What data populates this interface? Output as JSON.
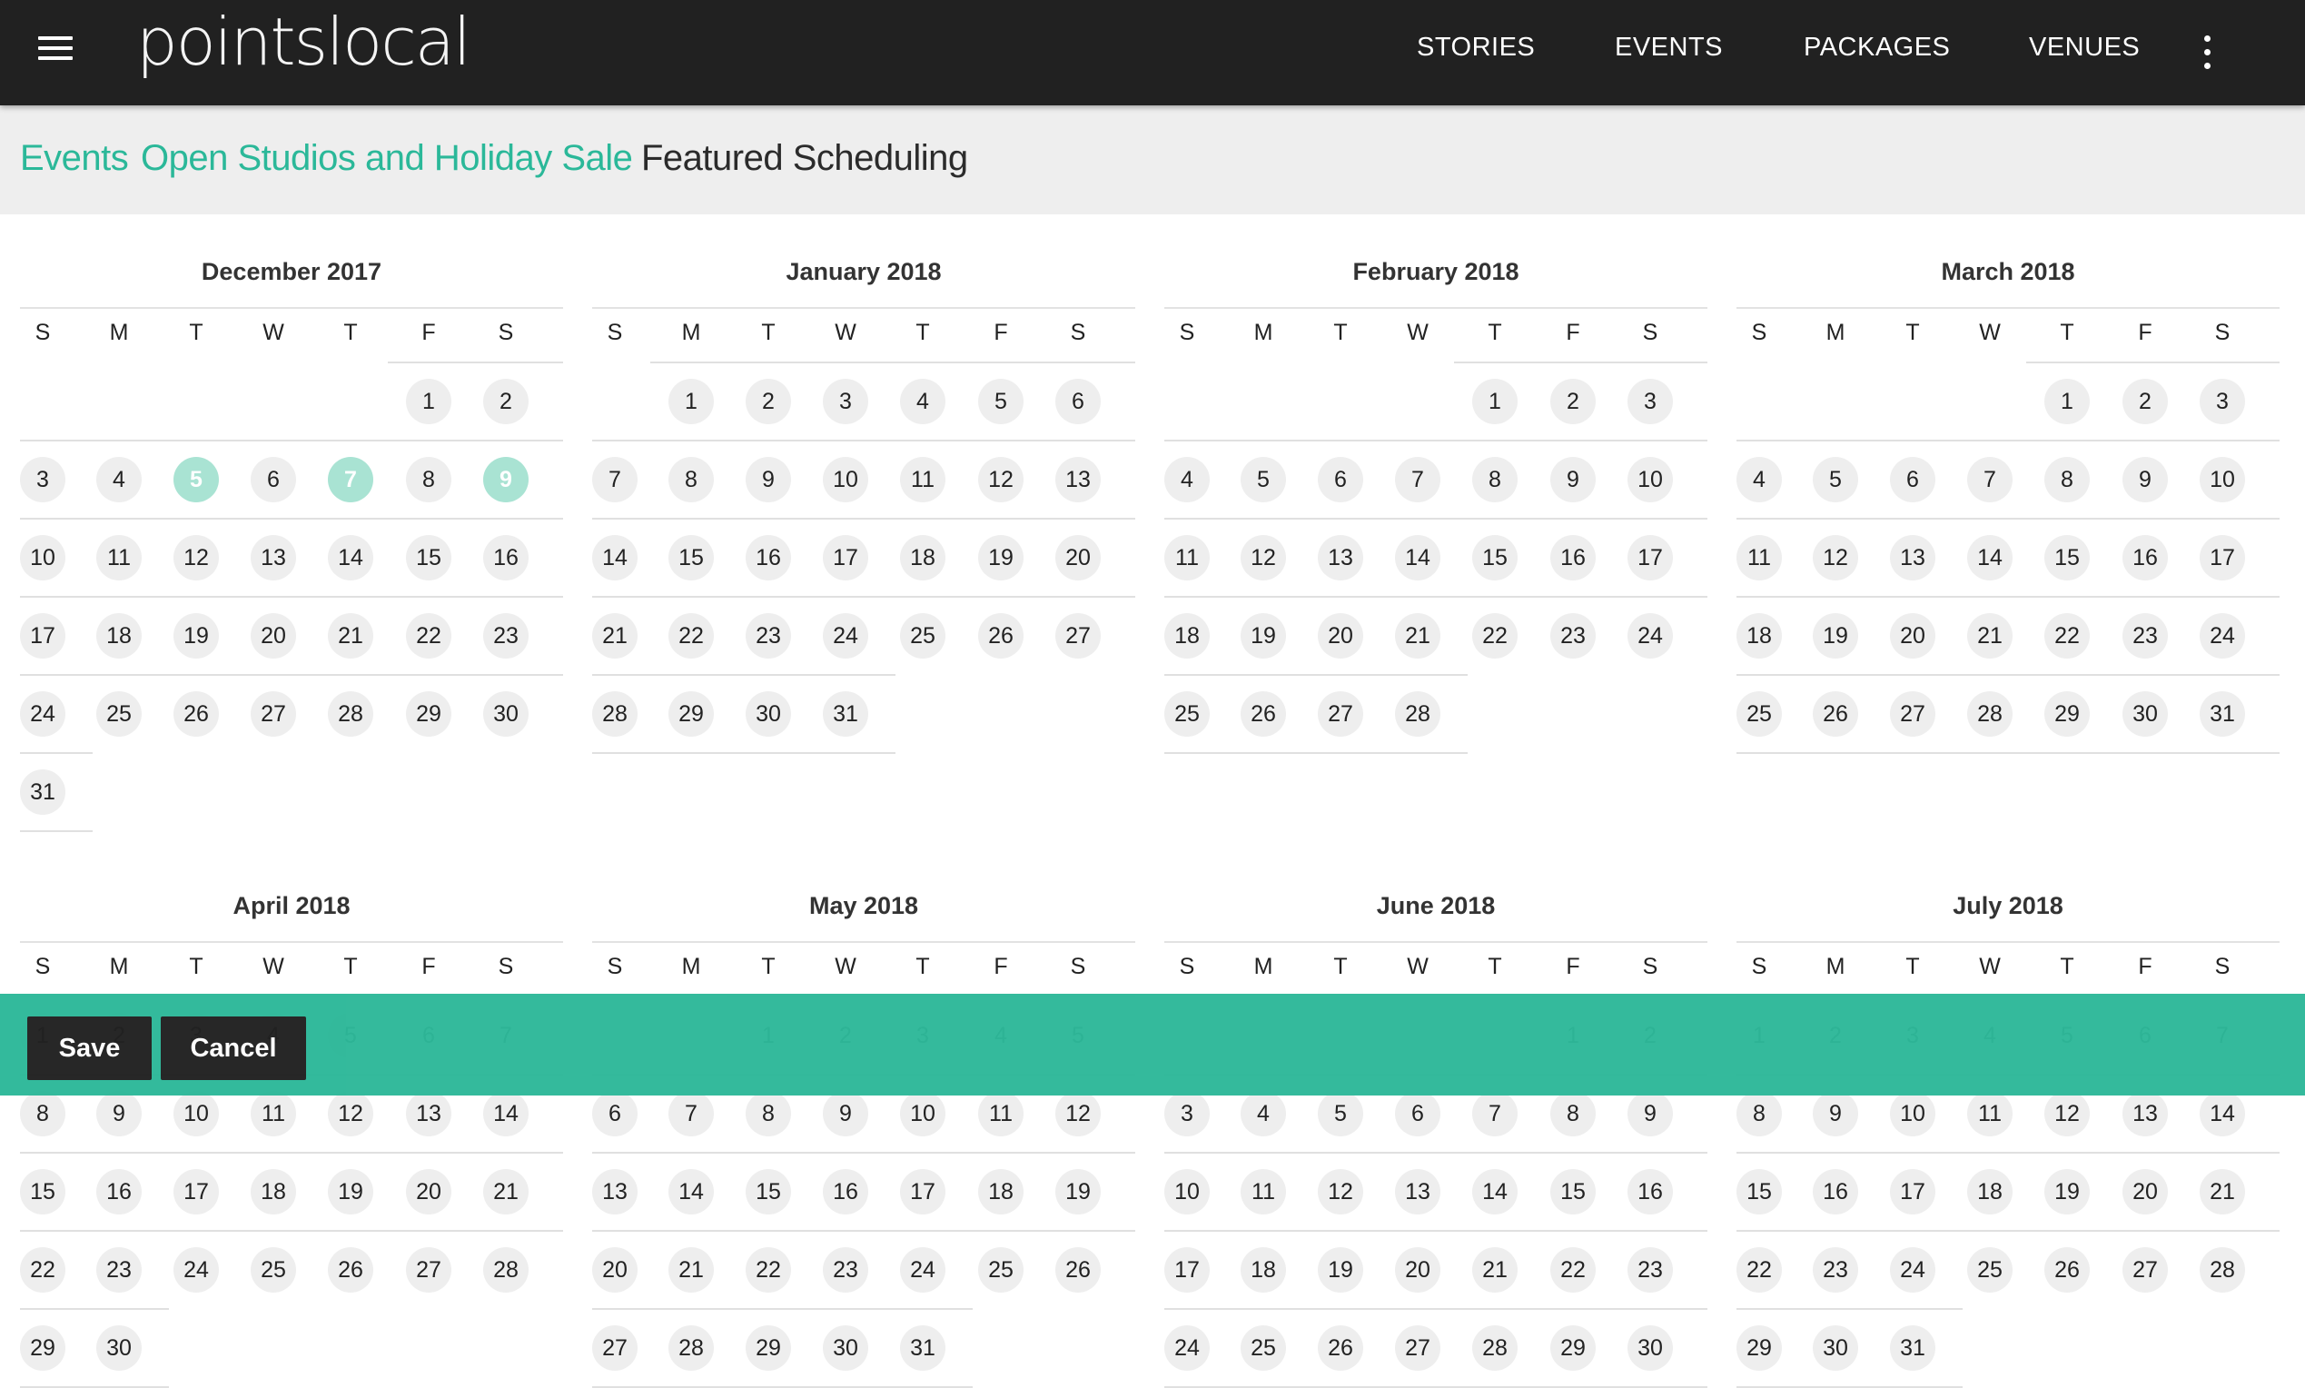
{
  "app": {
    "logo": "pointslocal"
  },
  "nav": {
    "items": [
      "STORIES",
      "EVENTS",
      "PACKAGES",
      "VENUES"
    ]
  },
  "breadcrumb": {
    "items": [
      {
        "label": "Events",
        "link": true
      },
      {
        "label": "Open Studios and Holiday Sale",
        "link": true
      },
      {
        "label": "Featured Scheduling",
        "link": false
      }
    ]
  },
  "calendar": {
    "weekday_labels": [
      "S",
      "M",
      "T",
      "W",
      "T",
      "F",
      "S"
    ],
    "months": [
      {
        "title": "December 2017",
        "first_weekday": 5,
        "days": 31,
        "selected": [
          5,
          7,
          9
        ]
      },
      {
        "title": "January 2018",
        "first_weekday": 1,
        "days": 31,
        "selected": []
      },
      {
        "title": "February 2018",
        "first_weekday": 4,
        "days": 28,
        "selected": []
      },
      {
        "title": "March 2018",
        "first_weekday": 4,
        "days": 31,
        "selected": []
      },
      {
        "title": "April 2018",
        "first_weekday": 0,
        "days": 30,
        "selected": []
      },
      {
        "title": "May 2018",
        "first_weekday": 2,
        "days": 31,
        "selected": []
      },
      {
        "title": "June 2018",
        "first_weekday": 5,
        "days": 30,
        "selected": []
      },
      {
        "title": "July 2018",
        "first_weekday": 0,
        "days": 31,
        "selected": []
      }
    ]
  },
  "footer": {
    "save_label": "Save",
    "cancel_label": "Cancel"
  },
  "colors": {
    "accent": "#2bb899",
    "topbar": "#212121",
    "selected_day": "#a9e3d3"
  }
}
